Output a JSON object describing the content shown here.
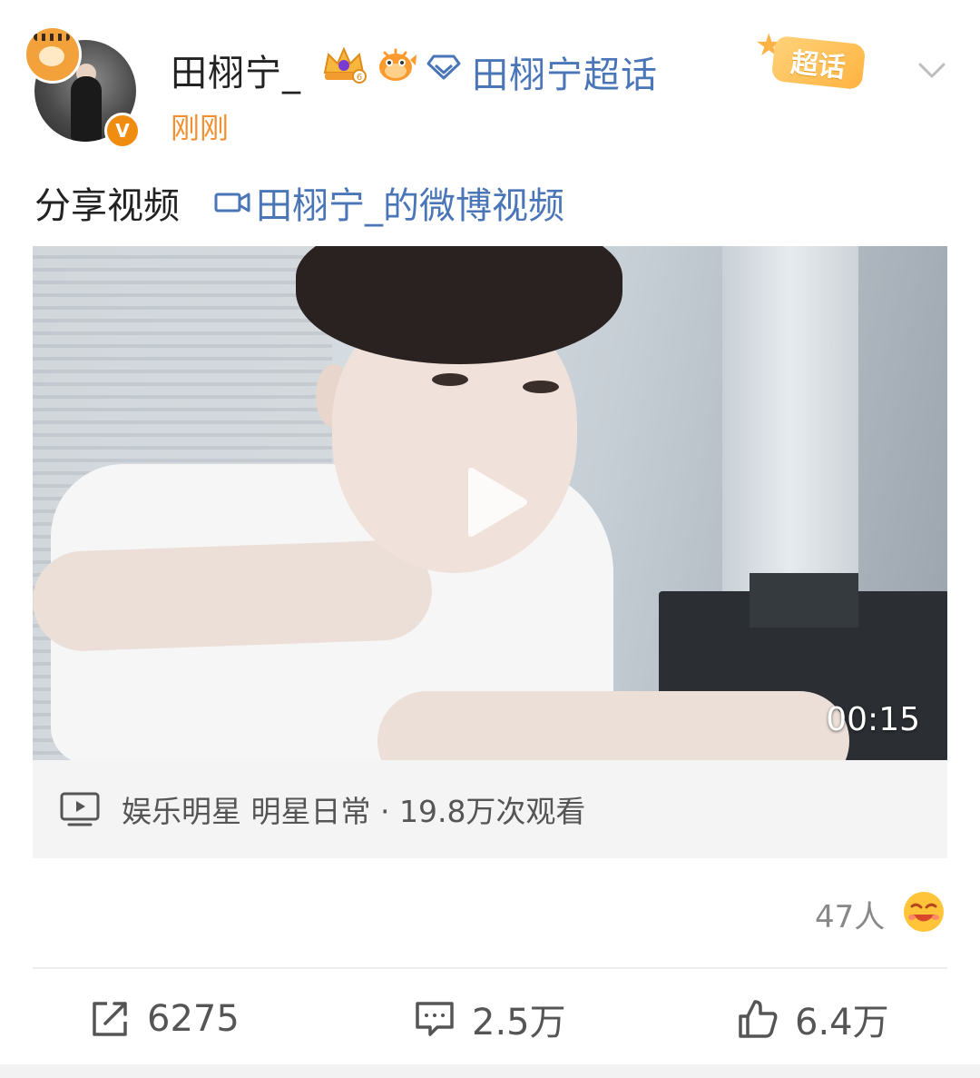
{
  "header": {
    "username": "田栩宁_",
    "supertopic_link": "田栩宁超话",
    "time": "刚刚",
    "chaohua_label": "超话",
    "verified_mark": "V"
  },
  "post": {
    "text": "分享视频",
    "video_link": "田栩宁_的微博视频"
  },
  "video": {
    "duration": "00:15",
    "meta": "娱乐明星 明星日常 · 19.8万次观看"
  },
  "reactions": {
    "count": "47人"
  },
  "actions": {
    "share": "6275",
    "comment": "2.5万",
    "like": "6.4万"
  },
  "colors": {
    "link": "#4a76b8",
    "time": "#f09030",
    "verified": "#f08c10"
  }
}
